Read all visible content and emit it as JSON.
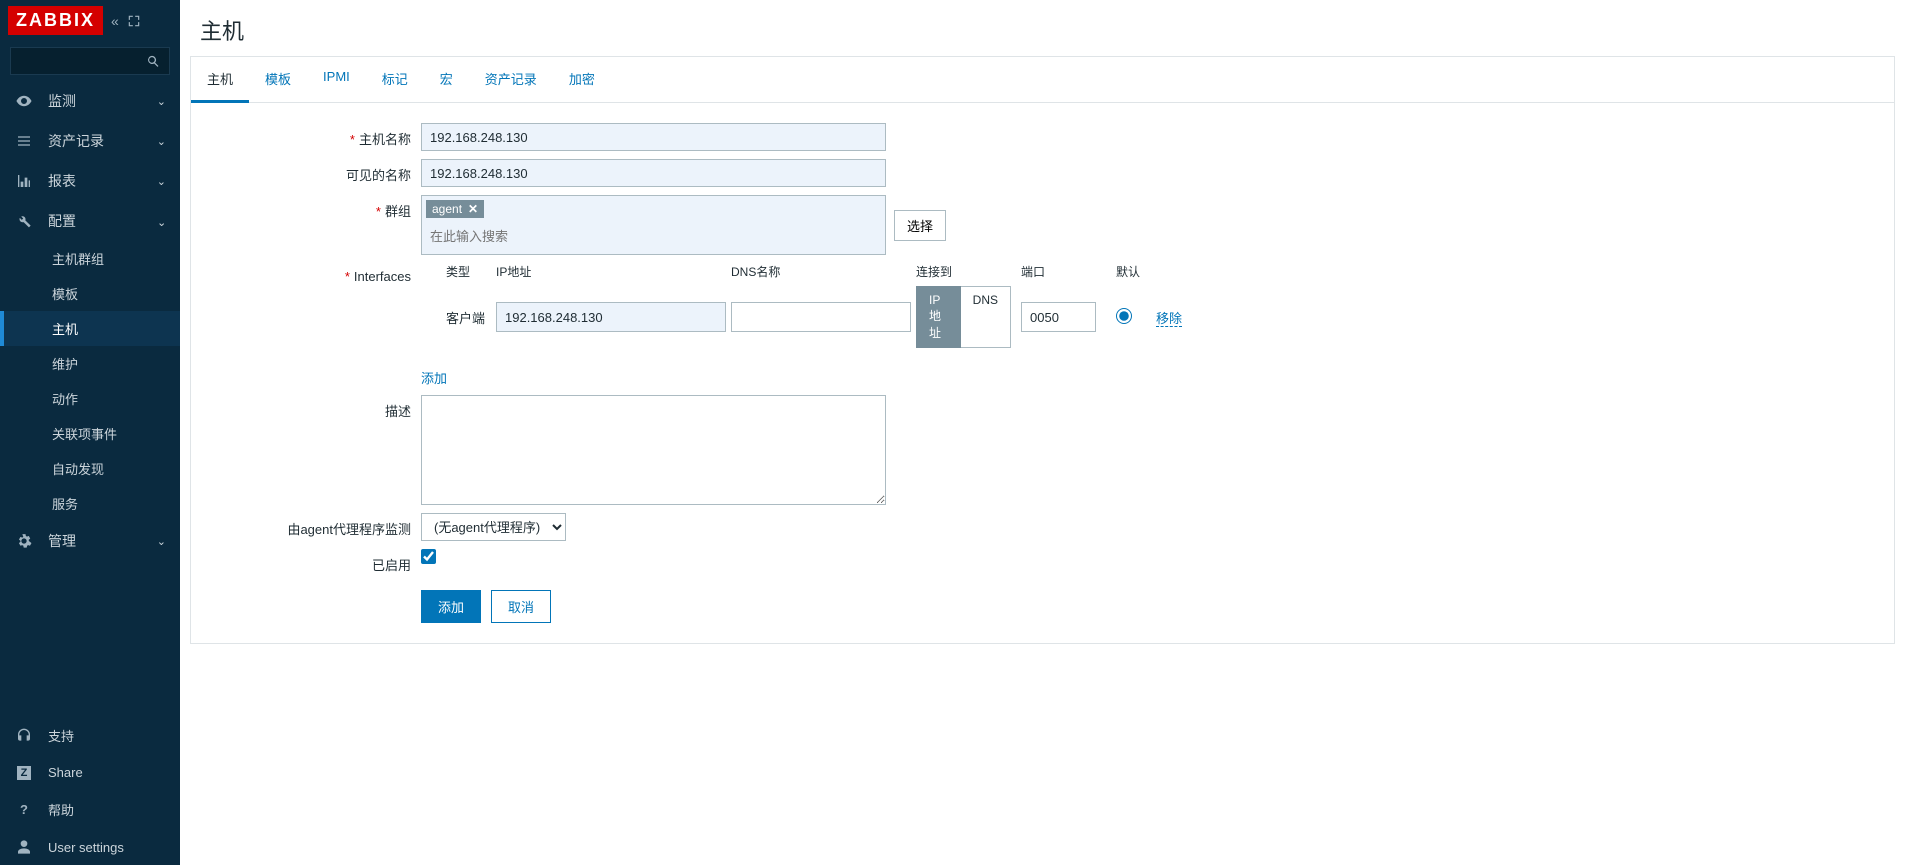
{
  "brand": "ZABBIX",
  "header": {
    "title": "主机"
  },
  "search": {
    "placeholder": ""
  },
  "nav": {
    "monitor": "监测",
    "inventory": "资产记录",
    "reports": "报表",
    "config": "配置",
    "admin": "管理"
  },
  "subnav": {
    "host_groups": "主机群组",
    "templates": "模板",
    "hosts": "主机",
    "maintenance": "维护",
    "actions": "动作",
    "correlation": "关联项事件",
    "discovery": "自动发现",
    "services": "服务"
  },
  "footer_nav": {
    "support": "支持",
    "share": "Share",
    "help": "帮助",
    "user": "User settings"
  },
  "tabs": {
    "host": "主机",
    "templates": "模板",
    "ipmi": "IPMI",
    "tags": "标记",
    "macros": "宏",
    "inventory": "资产记录",
    "encryption": "加密"
  },
  "form": {
    "host_name_label": "主机名称",
    "host_name_value": "192.168.248.130",
    "visible_name_label": "可见的名称",
    "visible_name_value": "192.168.248.130",
    "groups_label": "群组",
    "groups_tag": "agent",
    "groups_placeholder": "在此输入搜索",
    "select_btn": "选择",
    "interfaces_label": "Interfaces",
    "iface_head": {
      "type": "类型",
      "ip": "IP地址",
      "dns": "DNS名称",
      "conn": "连接到",
      "port": "端口",
      "def": "默认"
    },
    "iface_row": {
      "type": "客户端",
      "ip": "192.168.248.130",
      "dns": "",
      "conn_ip": "IP地址",
      "conn_dns": "DNS",
      "port": "0050",
      "remove": "移除"
    },
    "add_link": "添加",
    "description_label": "描述",
    "description_value": "",
    "proxy_label": "由agent代理程序监测",
    "proxy_value": "(无agent代理程序)",
    "enabled_label": "已启用",
    "submit": "添加",
    "cancel": "取消"
  }
}
